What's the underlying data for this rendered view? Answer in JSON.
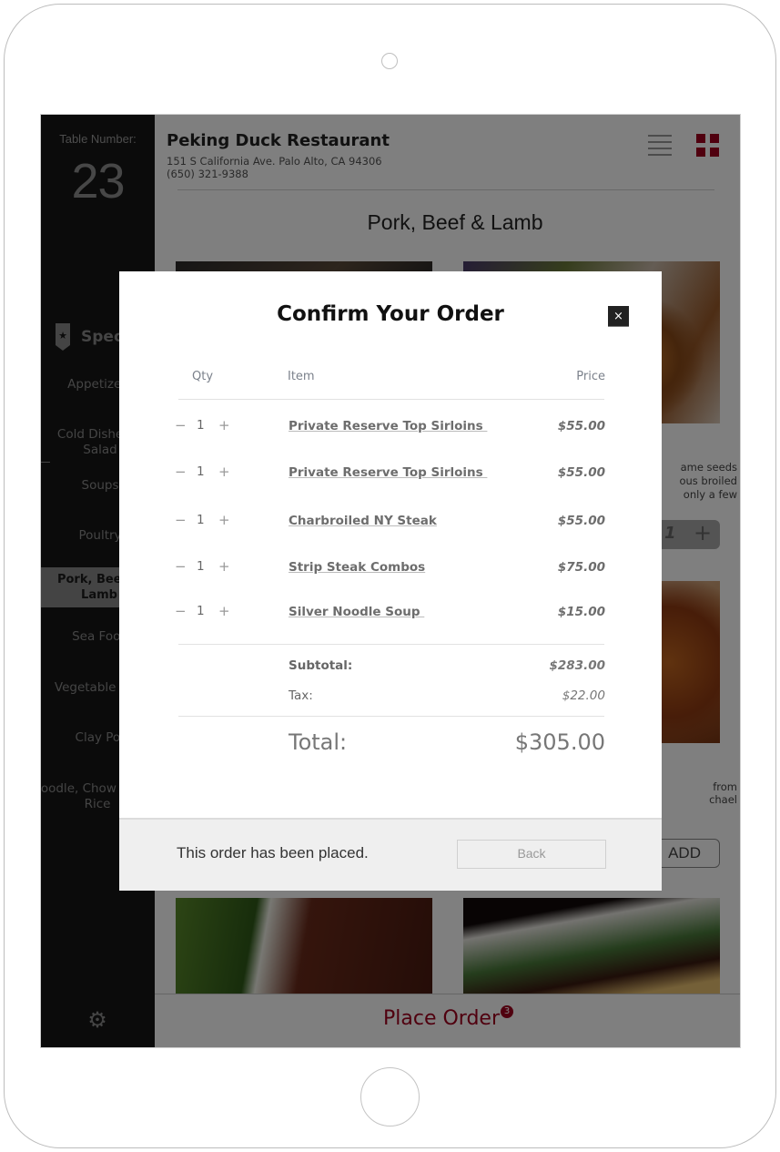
{
  "sidebar": {
    "table_label": "Table Number:",
    "table_number": "23",
    "specials_label": "Specials",
    "categories": [
      {
        "label": "Appetizers"
      },
      {
        "label": "Cold Dishes & Salad"
      },
      {
        "label": "Soups"
      },
      {
        "label": "Poultry"
      },
      {
        "label": "Pork, Beef & Lamb",
        "active": true
      },
      {
        "label": "Sea Food"
      },
      {
        "label": "Vegetable & Tofu"
      },
      {
        "label": "Clay Pot"
      },
      {
        "label": "Noodle, Chow Mein & Rice"
      }
    ],
    "settings_icon": "gear-icon"
  },
  "header": {
    "restaurant_name": "Peking Duck Restaurant",
    "address": "151 S California Ave. Palo Alto, CA 94306",
    "phone": "(650) 321-9388",
    "view_icons": [
      "list-view-icon",
      "grid-view-icon"
    ],
    "accent_color": "#a1001f"
  },
  "main": {
    "category_title": "Pork, Beef & Lamb",
    "partial_desc_1": [
      "ame seeds",
      "ous broiled",
      "only a few"
    ],
    "partial_qty": "1",
    "partial_desc_2": [
      "from",
      "chael"
    ],
    "add_label": "ADD"
  },
  "order_bar": {
    "place_order_label": "Place Order",
    "item_count": "3"
  },
  "modal": {
    "title": "Confirm Your Order",
    "close_label": "×",
    "columns": {
      "qty": "Qty",
      "item": "Item",
      "price": "Price"
    },
    "items": [
      {
        "qty": "1",
        "name": "Private Reserve Top Sirloins ",
        "price": "$55.00"
      },
      {
        "qty": "1",
        "name": "Private Reserve Top Sirloins ",
        "price": "$55.00"
      },
      {
        "qty": "1",
        "name": "Charbroiled NY Steak",
        "price": "$55.00"
      },
      {
        "qty": "1",
        "name": "Strip Steak Combos",
        "price": "$75.00"
      },
      {
        "qty": "1",
        "name": "Silver Noodle Soup ",
        "price": "$15.00"
      }
    ],
    "subtotal_label": "Subtotal:",
    "subtotal": "$283.00",
    "tax_label": "Tax:",
    "tax": "$22.00",
    "total_label": "Total:",
    "total": "$305.00",
    "status_message": "This order has been placed.",
    "back_label": "Back"
  }
}
